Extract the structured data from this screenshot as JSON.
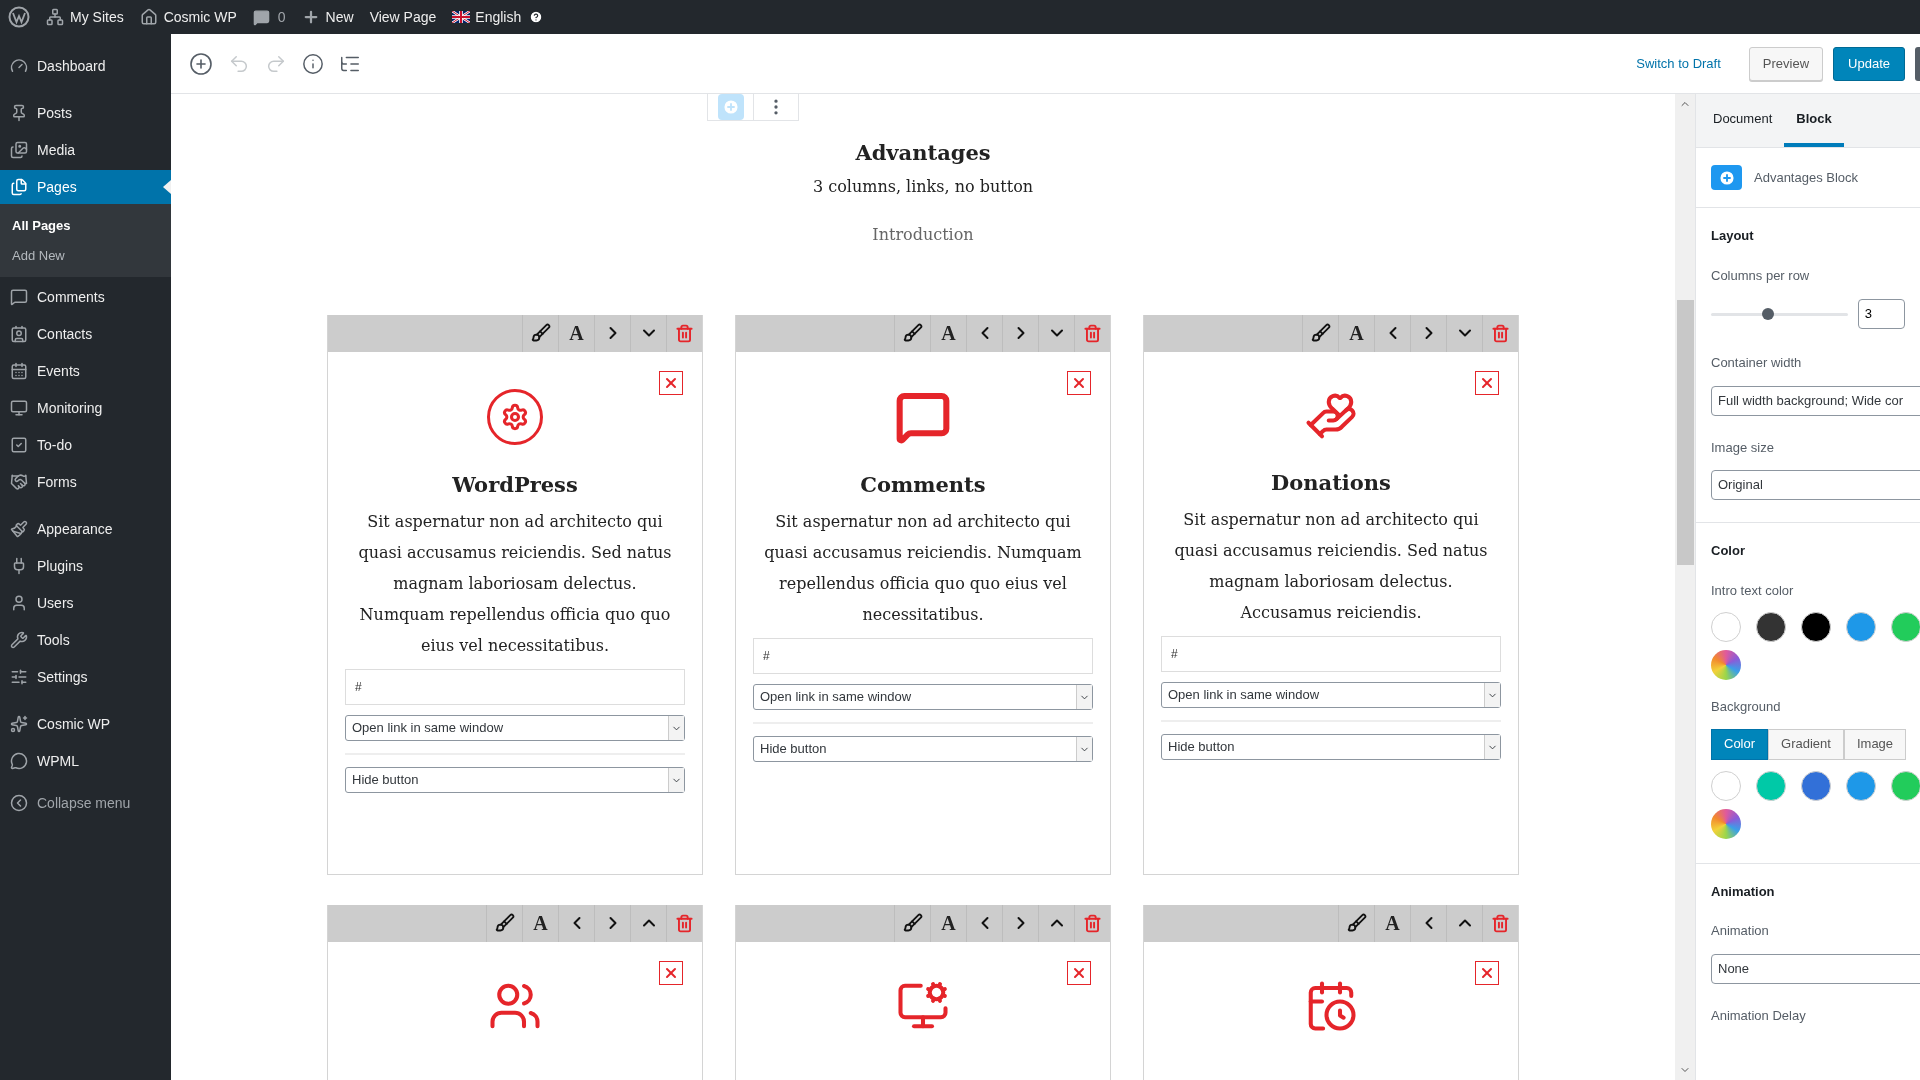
{
  "admin_bar": {
    "my_sites": "My Sites",
    "site": "Cosmic WP",
    "comments_count": "0",
    "new": "New",
    "view_page": "View Page",
    "language": "English"
  },
  "sidebar": {
    "groups": [
      [
        {
          "label": "Dashboard",
          "selected": false
        }
      ],
      [
        {
          "label": "Posts",
          "selected": false
        },
        {
          "label": "Media",
          "selected": false
        },
        {
          "label": "Pages",
          "selected": true,
          "children": [
            {
              "label": "All Pages",
              "selected": true
            },
            {
              "label": "Add New",
              "selected": false
            }
          ]
        },
        {
          "label": "Comments",
          "selected": false
        },
        {
          "label": "Contacts",
          "selected": false
        },
        {
          "label": "Events",
          "selected": false
        },
        {
          "label": "Monitoring",
          "selected": false
        },
        {
          "label": "To-do",
          "selected": false
        },
        {
          "label": "Forms",
          "selected": false
        }
      ],
      [
        {
          "label": "Appearance",
          "selected": false
        },
        {
          "label": "Plugins",
          "selected": false
        },
        {
          "label": "Users",
          "selected": false
        },
        {
          "label": "Tools",
          "selected": false
        },
        {
          "label": "Settings",
          "selected": false
        }
      ],
      [
        {
          "label": "Cosmic WP",
          "selected": false
        },
        {
          "label": "WPML",
          "selected": false
        }
      ]
    ],
    "collapse": "Collapse menu"
  },
  "editor_toolbar": {
    "undo_disabled": true,
    "redo_disabled": true,
    "switch_to_draft": "Switch to Draft",
    "preview": "Preview",
    "update": "Update"
  },
  "content": {
    "title": "Advantages",
    "subtitle": "3 columns, links, no button",
    "intro": "Introduction",
    "cards": [
      {
        "controls": [
          {
            "kind": "style"
          },
          {
            "kind": "font",
            "label": "A"
          },
          {
            "kind": "right"
          },
          {
            "kind": "down"
          },
          {
            "kind": "delete"
          }
        ],
        "title": "WordPress",
        "text": "Sit aspernatur non ad architecto qui quasi accusamus reiciendis. Sed natus magnam laboriosam delectus. Numquam repellendus officia quo quo eius vel necessitatibus.",
        "link": "#",
        "link_target": "Open link in same window",
        "button": "Hide button"
      },
      {
        "controls": [
          {
            "kind": "style"
          },
          {
            "kind": "font",
            "label": "A"
          },
          {
            "kind": "left"
          },
          {
            "kind": "right"
          },
          {
            "kind": "down"
          },
          {
            "kind": "delete"
          }
        ],
        "title": "Comments",
        "text": "Sit aspernatur non ad architecto qui quasi accusamus reiciendis. Numquam repellendus officia quo quo eius vel necessitatibus.",
        "link": "#",
        "link_target": "Open link in same window",
        "button": "Hide button"
      },
      {
        "controls": [
          {
            "kind": "style"
          },
          {
            "kind": "font",
            "label": "A"
          },
          {
            "kind": "left"
          },
          {
            "kind": "right"
          },
          {
            "kind": "down"
          },
          {
            "kind": "delete"
          }
        ],
        "title": "Donations",
        "text": "Sit aspernatur non ad architecto qui quasi accusamus reiciendis. Sed natus magnam laboriosam delectus. Accusamus reiciendis.",
        "link": "#",
        "link_target": "Open link in same window",
        "button": "Hide button"
      },
      {
        "controls": [
          {
            "kind": "style"
          },
          {
            "kind": "font",
            "label": "A"
          },
          {
            "kind": "left"
          },
          {
            "kind": "right"
          },
          {
            "kind": "up"
          },
          {
            "kind": "delete"
          }
        ]
      },
      {
        "controls": [
          {
            "kind": "style"
          },
          {
            "kind": "font",
            "label": "A"
          },
          {
            "kind": "left"
          },
          {
            "kind": "right"
          },
          {
            "kind": "up"
          },
          {
            "kind": "delete"
          }
        ]
      },
      {
        "controls": [
          {
            "kind": "style"
          },
          {
            "kind": "font",
            "label": "A"
          },
          {
            "kind": "left"
          },
          {
            "kind": "up"
          },
          {
            "kind": "delete"
          }
        ]
      }
    ]
  },
  "settings_panel": {
    "tabs": [
      {
        "label": "Document",
        "selected": false
      },
      {
        "label": "Block",
        "selected": true
      }
    ],
    "block_name": "Advantages Block",
    "layout": {
      "heading": "Layout",
      "columns_label": "Columns per row",
      "columns": {
        "level": 0.42,
        "value": "3"
      },
      "container_label": "Container width",
      "container_value": "Full width background; Wide cor",
      "image_label": "Image size",
      "image_value": "Original"
    },
    "color": {
      "heading": "Color",
      "intro_label": "Intro text color",
      "intro_swatches": [
        {
          "color": "#ffffff"
        },
        {
          "color": "#333333"
        },
        {
          "color": "#000000"
        },
        {
          "color": "#1e98e8"
        },
        {
          "color": "#22cc5b"
        }
      ],
      "background_label": "Background",
      "background_tabs": [
        {
          "label": "Color",
          "selected": true
        },
        {
          "label": "Gradient",
          "selected": false
        },
        {
          "label": "Image",
          "selected": false
        }
      ],
      "background_swatches": [
        {
          "color": "#ffffff"
        },
        {
          "color": "#00c9a7"
        },
        {
          "color": "#3270d8"
        },
        {
          "color": "#1e98e8"
        },
        {
          "color": "#22cc5b"
        }
      ]
    },
    "animation": {
      "heading": "Animation",
      "animation_label": "Animation",
      "animation_value": "None",
      "delay_label": "Animation Delay"
    }
  }
}
